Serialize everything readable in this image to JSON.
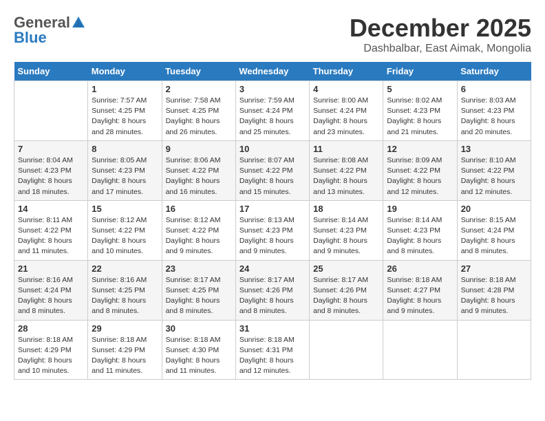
{
  "header": {
    "logo_general": "General",
    "logo_blue": "Blue",
    "month_title": "December 2025",
    "subtitle": "Dashbalbar, East Aimak, Mongolia"
  },
  "weekdays": [
    "Sunday",
    "Monday",
    "Tuesday",
    "Wednesday",
    "Thursday",
    "Friday",
    "Saturday"
  ],
  "weeks": [
    [
      {
        "day": "",
        "sunrise": "",
        "sunset": "",
        "daylight": ""
      },
      {
        "day": "1",
        "sunrise": "Sunrise: 7:57 AM",
        "sunset": "Sunset: 4:25 PM",
        "daylight": "Daylight: 8 hours and 28 minutes."
      },
      {
        "day": "2",
        "sunrise": "Sunrise: 7:58 AM",
        "sunset": "Sunset: 4:25 PM",
        "daylight": "Daylight: 8 hours and 26 minutes."
      },
      {
        "day": "3",
        "sunrise": "Sunrise: 7:59 AM",
        "sunset": "Sunset: 4:24 PM",
        "daylight": "Daylight: 8 hours and 25 minutes."
      },
      {
        "day": "4",
        "sunrise": "Sunrise: 8:00 AM",
        "sunset": "Sunset: 4:24 PM",
        "daylight": "Daylight: 8 hours and 23 minutes."
      },
      {
        "day": "5",
        "sunrise": "Sunrise: 8:02 AM",
        "sunset": "Sunset: 4:23 PM",
        "daylight": "Daylight: 8 hours and 21 minutes."
      },
      {
        "day": "6",
        "sunrise": "Sunrise: 8:03 AM",
        "sunset": "Sunset: 4:23 PM",
        "daylight": "Daylight: 8 hours and 20 minutes."
      }
    ],
    [
      {
        "day": "7",
        "sunrise": "Sunrise: 8:04 AM",
        "sunset": "Sunset: 4:23 PM",
        "daylight": "Daylight: 8 hours and 18 minutes."
      },
      {
        "day": "8",
        "sunrise": "Sunrise: 8:05 AM",
        "sunset": "Sunset: 4:23 PM",
        "daylight": "Daylight: 8 hours and 17 minutes."
      },
      {
        "day": "9",
        "sunrise": "Sunrise: 8:06 AM",
        "sunset": "Sunset: 4:22 PM",
        "daylight": "Daylight: 8 hours and 16 minutes."
      },
      {
        "day": "10",
        "sunrise": "Sunrise: 8:07 AM",
        "sunset": "Sunset: 4:22 PM",
        "daylight": "Daylight: 8 hours and 15 minutes."
      },
      {
        "day": "11",
        "sunrise": "Sunrise: 8:08 AM",
        "sunset": "Sunset: 4:22 PM",
        "daylight": "Daylight: 8 hours and 13 minutes."
      },
      {
        "day": "12",
        "sunrise": "Sunrise: 8:09 AM",
        "sunset": "Sunset: 4:22 PM",
        "daylight": "Daylight: 8 hours and 12 minutes."
      },
      {
        "day": "13",
        "sunrise": "Sunrise: 8:10 AM",
        "sunset": "Sunset: 4:22 PM",
        "daylight": "Daylight: 8 hours and 12 minutes."
      }
    ],
    [
      {
        "day": "14",
        "sunrise": "Sunrise: 8:11 AM",
        "sunset": "Sunset: 4:22 PM",
        "daylight": "Daylight: 8 hours and 11 minutes."
      },
      {
        "day": "15",
        "sunrise": "Sunrise: 8:12 AM",
        "sunset": "Sunset: 4:22 PM",
        "daylight": "Daylight: 8 hours and 10 minutes."
      },
      {
        "day": "16",
        "sunrise": "Sunrise: 8:12 AM",
        "sunset": "Sunset: 4:22 PM",
        "daylight": "Daylight: 8 hours and 9 minutes."
      },
      {
        "day": "17",
        "sunrise": "Sunrise: 8:13 AM",
        "sunset": "Sunset: 4:23 PM",
        "daylight": "Daylight: 8 hours and 9 minutes."
      },
      {
        "day": "18",
        "sunrise": "Sunrise: 8:14 AM",
        "sunset": "Sunset: 4:23 PM",
        "daylight": "Daylight: 8 hours and 9 minutes."
      },
      {
        "day": "19",
        "sunrise": "Sunrise: 8:14 AM",
        "sunset": "Sunset: 4:23 PM",
        "daylight": "Daylight: 8 hours and 8 minutes."
      },
      {
        "day": "20",
        "sunrise": "Sunrise: 8:15 AM",
        "sunset": "Sunset: 4:24 PM",
        "daylight": "Daylight: 8 hours and 8 minutes."
      }
    ],
    [
      {
        "day": "21",
        "sunrise": "Sunrise: 8:16 AM",
        "sunset": "Sunset: 4:24 PM",
        "daylight": "Daylight: 8 hours and 8 minutes."
      },
      {
        "day": "22",
        "sunrise": "Sunrise: 8:16 AM",
        "sunset": "Sunset: 4:25 PM",
        "daylight": "Daylight: 8 hours and 8 minutes."
      },
      {
        "day": "23",
        "sunrise": "Sunrise: 8:17 AM",
        "sunset": "Sunset: 4:25 PM",
        "daylight": "Daylight: 8 hours and 8 minutes."
      },
      {
        "day": "24",
        "sunrise": "Sunrise: 8:17 AM",
        "sunset": "Sunset: 4:26 PM",
        "daylight": "Daylight: 8 hours and 8 minutes."
      },
      {
        "day": "25",
        "sunrise": "Sunrise: 8:17 AM",
        "sunset": "Sunset: 4:26 PM",
        "daylight": "Daylight: 8 hours and 8 minutes."
      },
      {
        "day": "26",
        "sunrise": "Sunrise: 8:18 AM",
        "sunset": "Sunset: 4:27 PM",
        "daylight": "Daylight: 8 hours and 9 minutes."
      },
      {
        "day": "27",
        "sunrise": "Sunrise: 8:18 AM",
        "sunset": "Sunset: 4:28 PM",
        "daylight": "Daylight: 8 hours and 9 minutes."
      }
    ],
    [
      {
        "day": "28",
        "sunrise": "Sunrise: 8:18 AM",
        "sunset": "Sunset: 4:29 PM",
        "daylight": "Daylight: 8 hours and 10 minutes."
      },
      {
        "day": "29",
        "sunrise": "Sunrise: 8:18 AM",
        "sunset": "Sunset: 4:29 PM",
        "daylight": "Daylight: 8 hours and 11 minutes."
      },
      {
        "day": "30",
        "sunrise": "Sunrise: 8:18 AM",
        "sunset": "Sunset: 4:30 PM",
        "daylight": "Daylight: 8 hours and 11 minutes."
      },
      {
        "day": "31",
        "sunrise": "Sunrise: 8:18 AM",
        "sunset": "Sunset: 4:31 PM",
        "daylight": "Daylight: 8 hours and 12 minutes."
      },
      {
        "day": "",
        "sunrise": "",
        "sunset": "",
        "daylight": ""
      },
      {
        "day": "",
        "sunrise": "",
        "sunset": "",
        "daylight": ""
      },
      {
        "day": "",
        "sunrise": "",
        "sunset": "",
        "daylight": ""
      }
    ]
  ]
}
